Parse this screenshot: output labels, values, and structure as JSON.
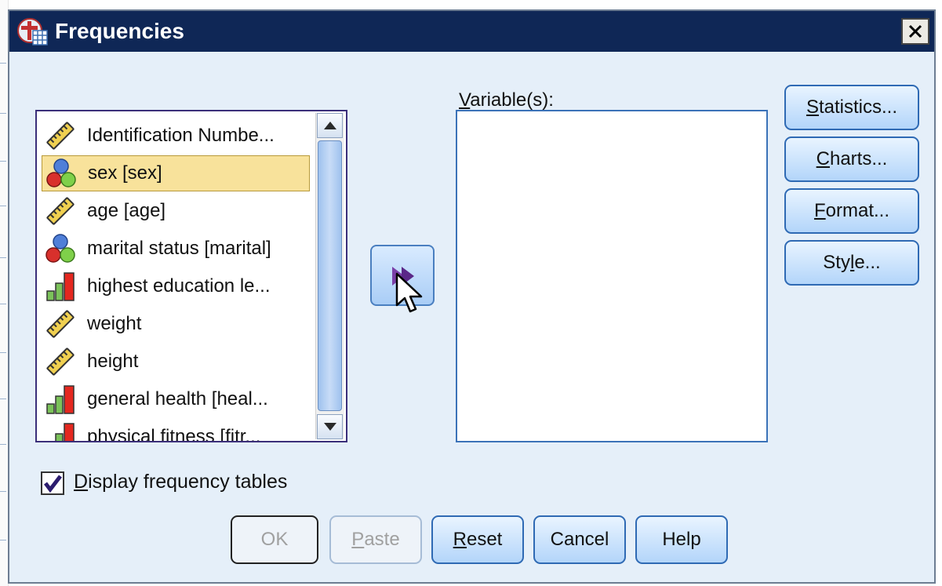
{
  "window": {
    "title": "Frequencies",
    "close_glyph": "✕"
  },
  "source_list": {
    "items": [
      {
        "label": "Identification Numbe...",
        "icon": "scale-ruler-icon",
        "selected": false
      },
      {
        "label": "sex [sex]",
        "icon": "nominal-icon",
        "selected": true
      },
      {
        "label": "age [age]",
        "icon": "scale-ruler-icon",
        "selected": false
      },
      {
        "label": "marital status [marital]",
        "icon": "nominal-icon",
        "selected": false
      },
      {
        "label": "highest education le...",
        "icon": "ordinal-icon",
        "selected": false
      },
      {
        "label": "weight",
        "icon": "scale-ruler-icon",
        "selected": false
      },
      {
        "label": "height",
        "icon": "scale-ruler-icon",
        "selected": false
      },
      {
        "label": "general health [heal...",
        "icon": "ordinal-icon",
        "selected": false
      },
      {
        "label": "physical fitness [fitr...",
        "icon": "ordinal-icon",
        "selected": false
      }
    ]
  },
  "target": {
    "label_first": "V",
    "label_rest": "ariable(s):"
  },
  "side_buttons": [
    {
      "pre": "",
      "ul": "S",
      "post": "tatistics..."
    },
    {
      "pre": "",
      "ul": "C",
      "post": "harts..."
    },
    {
      "pre": "",
      "ul": "F",
      "post": "ormat..."
    },
    {
      "pre": "Sty",
      "ul": "l",
      "post": "e..."
    }
  ],
  "display_frequency": {
    "checked": true,
    "ul": "D",
    "rest": "isplay frequency tables"
  },
  "bottom_buttons": [
    {
      "label": "OK",
      "ul": "",
      "enabled": false
    },
    {
      "label": "aste",
      "ul": "P",
      "enabled": false
    },
    {
      "label": "eset",
      "ul": "R",
      "enabled": true
    },
    {
      "label": "Cancel",
      "ul": "",
      "enabled": true
    },
    {
      "label": "Help",
      "ul": "",
      "enabled": true
    }
  ],
  "colors": {
    "title_bar": "#0f2756",
    "dialog_bg": "#e5eff9",
    "selection": "#f8e29b",
    "button_border": "#2f6ab4"
  }
}
